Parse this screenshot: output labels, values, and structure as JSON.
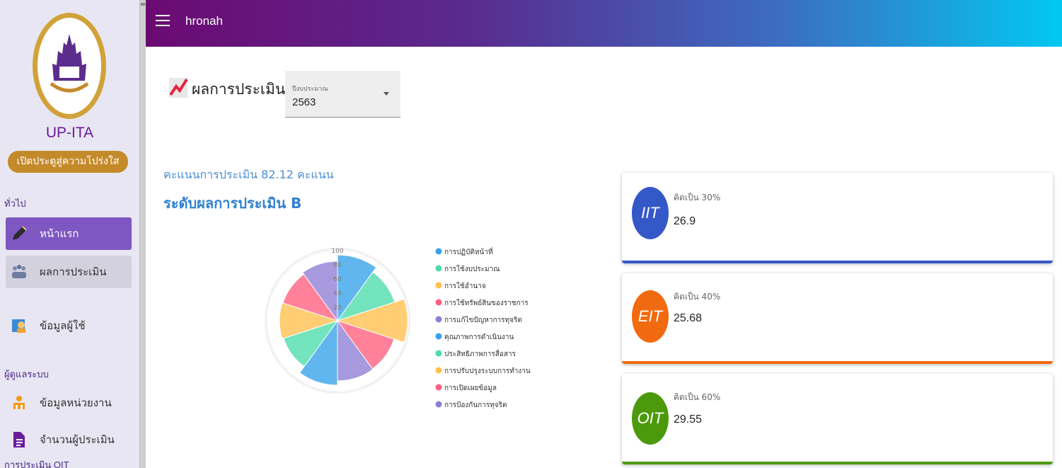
{
  "header": {
    "title": "hronah"
  },
  "sidebar": {
    "brand": "UP-ITA",
    "tagline": "เปิดประตูสู่ความโปร่งใส",
    "section_general": "ทั่วไป",
    "items": [
      {
        "label": "หน้าแรก",
        "icon": "pen-icon"
      },
      {
        "label": "ผลการประเมิน",
        "icon": "people-icon"
      },
      {
        "label": "ข้อมูลผู้ใช้",
        "icon": "user-card-icon"
      }
    ],
    "section_admin": "ผู้ดูแลระบบ",
    "admin_items": [
      {
        "label": "ข้อมูลหน่วยงาน",
        "icon": "org-icon"
      },
      {
        "label": "จำนวนผู้ประเมิน",
        "icon": "document-icon"
      }
    ],
    "section_oit": "การประเมิน OIT"
  },
  "page": {
    "title": "ผลการประเมิน",
    "year_select": {
      "label": "ปีงบประมาณ",
      "value": "2563"
    },
    "score_text": "คะแนนการประเมิน 82.12 คะแนน",
    "level_text": "ระดับผลการประเมิน B"
  },
  "chart_data": {
    "type": "polar-area",
    "r_ticks": [
      "20",
      "40",
      "60",
      "80",
      "100"
    ],
    "rlim": [
      0,
      100
    ],
    "categories": [
      "การปฏิบัติหน้าที่",
      "การใช้งบประมาณ",
      "การใช้อำนาจ",
      "การใช้ทรัพย์สินของราชการ",
      "การแก้ไขปัญหาการทุจริต",
      "คุณภาพการดำเนินงาน",
      "ประสิทธิภาพการสื่อสาร",
      "การปรับปรุงระบบการทำงาน",
      "การเปิดเผยข้อมูล",
      "การป้องกันการทุจริต"
    ],
    "values": [
      93,
      85,
      99,
      84,
      85,
      91,
      80,
      82,
      81,
      84
    ],
    "colors": [
      "#36a2eb",
      "#4bdcaa",
      "#ffc04d",
      "#ff5f7e",
      "#8e7dd6",
      "#36a2eb",
      "#4bdcaa",
      "#ffc04d",
      "#ff5f7e",
      "#8e7dd6"
    ],
    "legend_position": "right"
  },
  "cards": [
    {
      "abbr": "IIT",
      "percent_text": "คิดเป็น 30%",
      "value": "26.9",
      "color": "#3558c8"
    },
    {
      "abbr": "EIT",
      "percent_text": "คิดเป็น 40%",
      "value": "25.68",
      "color": "#f26a0f"
    },
    {
      "abbr": "OIT",
      "percent_text": "คิดเป็น 60%",
      "value": "29.55",
      "color": "#4c9a0c"
    }
  ]
}
